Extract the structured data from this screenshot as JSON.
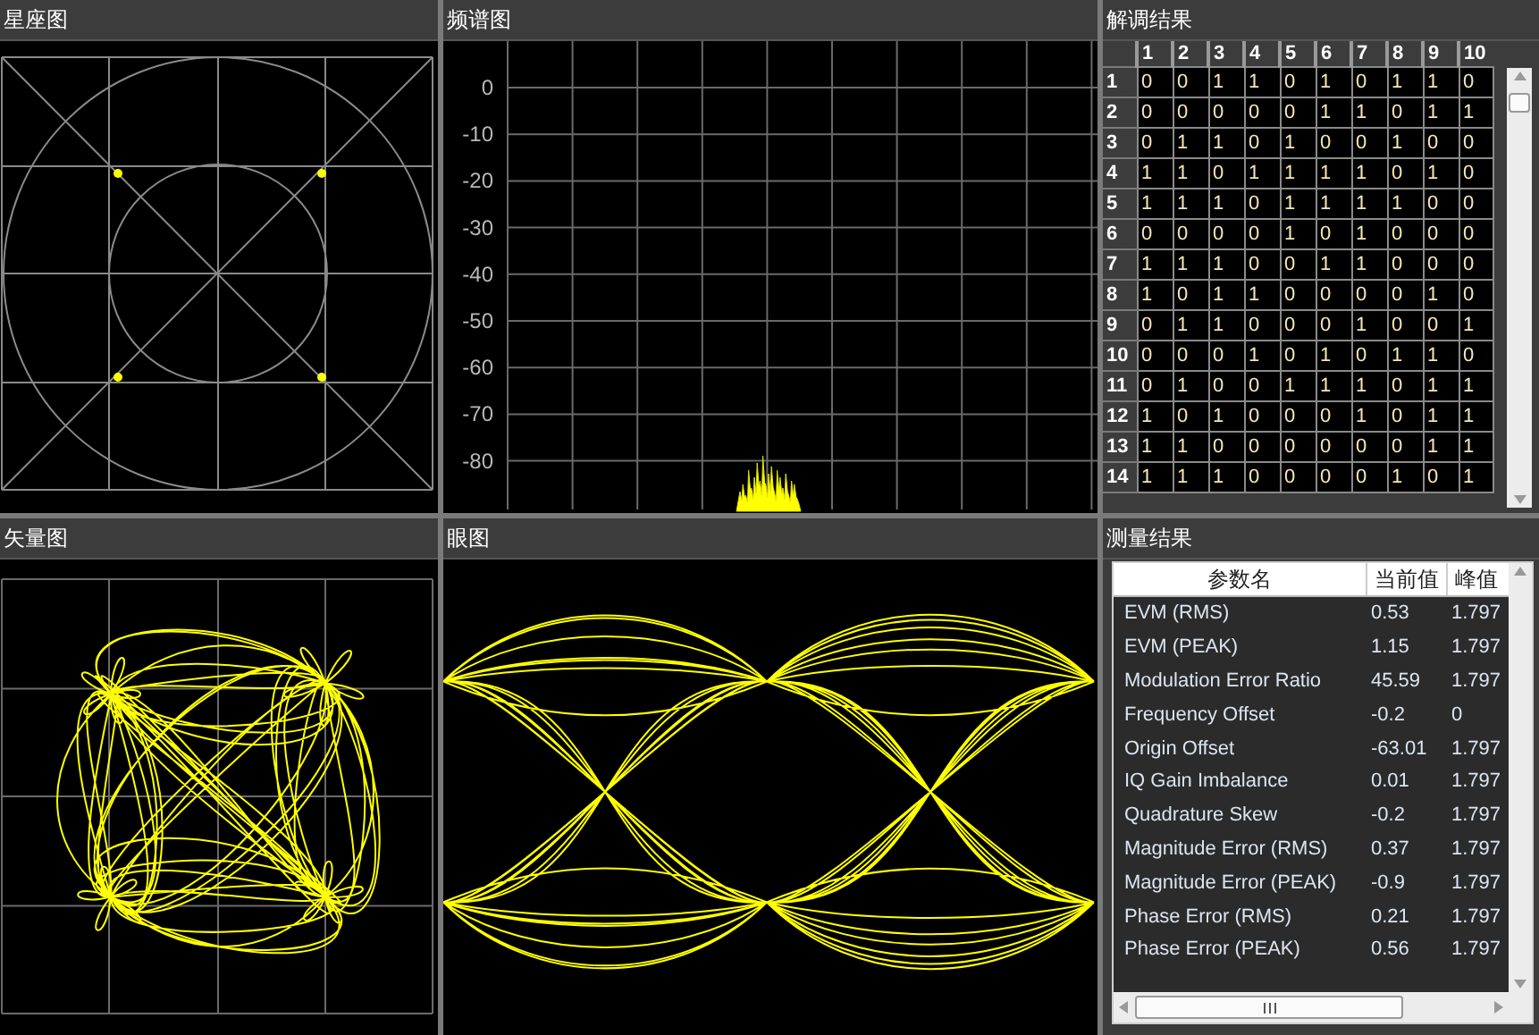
{
  "constellation": {
    "title": "星座图"
  },
  "spectrum": {
    "title": "频谱图",
    "y_axis_labels": [
      "0",
      "-10",
      "-20",
      "-30",
      "-40",
      "-50",
      "-60",
      "-70",
      "-80"
    ]
  },
  "demodulation": {
    "title": "解调结果",
    "columns": [
      "1",
      "2",
      "3",
      "4",
      "5",
      "6",
      "7",
      "8",
      "9",
      "10"
    ],
    "rows": [
      {
        "label": "1",
        "bits": [
          "0",
          "0",
          "1",
          "1",
          "0",
          "1",
          "0",
          "1",
          "1",
          "0"
        ]
      },
      {
        "label": "2",
        "bits": [
          "0",
          "0",
          "0",
          "0",
          "0",
          "1",
          "1",
          "0",
          "1",
          "1"
        ]
      },
      {
        "label": "3",
        "bits": [
          "0",
          "1",
          "1",
          "0",
          "1",
          "0",
          "0",
          "1",
          "0",
          "0"
        ]
      },
      {
        "label": "4",
        "bits": [
          "1",
          "1",
          "0",
          "1",
          "1",
          "1",
          "1",
          "0",
          "1",
          "0"
        ]
      },
      {
        "label": "5",
        "bits": [
          "1",
          "1",
          "1",
          "0",
          "1",
          "1",
          "1",
          "1",
          "0",
          "0"
        ]
      },
      {
        "label": "6",
        "bits": [
          "0",
          "0",
          "0",
          "0",
          "1",
          "0",
          "1",
          "0",
          "0",
          "0"
        ]
      },
      {
        "label": "7",
        "bits": [
          "1",
          "1",
          "1",
          "0",
          "0",
          "1",
          "1",
          "0",
          "0",
          "0"
        ]
      },
      {
        "label": "8",
        "bits": [
          "1",
          "0",
          "1",
          "1",
          "0",
          "0",
          "0",
          "0",
          "1",
          "0"
        ]
      },
      {
        "label": "9",
        "bits": [
          "0",
          "1",
          "1",
          "0",
          "0",
          "0",
          "1",
          "0",
          "0",
          "1"
        ]
      },
      {
        "label": "10",
        "bits": [
          "0",
          "0",
          "0",
          "1",
          "0",
          "1",
          "0",
          "1",
          "1",
          "0"
        ]
      },
      {
        "label": "11",
        "bits": [
          "0",
          "1",
          "0",
          "0",
          "1",
          "1",
          "1",
          "0",
          "1",
          "1"
        ]
      },
      {
        "label": "12",
        "bits": [
          "1",
          "0",
          "1",
          "0",
          "0",
          "0",
          "1",
          "0",
          "1",
          "1"
        ]
      },
      {
        "label": "13",
        "bits": [
          "1",
          "1",
          "0",
          "0",
          "0",
          "0",
          "0",
          "0",
          "1",
          "1"
        ]
      },
      {
        "label": "14",
        "bits": [
          "1",
          "1",
          "1",
          "0",
          "0",
          "0",
          "0",
          "1",
          "0",
          "1"
        ]
      }
    ]
  },
  "vector": {
    "title": "矢量图"
  },
  "eye": {
    "title": "眼图"
  },
  "measurements": {
    "title": "测量结果",
    "columns": [
      "参数名",
      "当前值",
      "峰值"
    ],
    "rows": [
      {
        "name": "EVM (RMS)",
        "current": "0.53",
        "peak": "1.797"
      },
      {
        "name": "EVM (PEAK)",
        "current": "1.15",
        "peak": "1.797"
      },
      {
        "name": "Modulation Error Ratio",
        "current": "45.59",
        "peak": "1.797"
      },
      {
        "name": "Frequency Offset",
        "current": "-0.2",
        "peak": "0"
      },
      {
        "name": "Origin Offset",
        "current": "-63.01",
        "peak": "1.797"
      },
      {
        "name": "IQ Gain Imbalance",
        "current": "0.01",
        "peak": "1.797"
      },
      {
        "name": "Quadrature Skew",
        "current": "-0.2",
        "peak": "1.797"
      },
      {
        "name": "Magnitude Error (RMS)",
        "current": "0.37",
        "peak": "1.797"
      },
      {
        "name": "Magnitude Error (PEAK)",
        "current": "-0.9",
        "peak": "1.797"
      },
      {
        "name": "Phase Error (RMS)",
        "current": "0.21",
        "peak": "1.797"
      },
      {
        "name": "Phase Error (PEAK)",
        "current": "0.56",
        "peak": "1.797"
      }
    ]
  }
}
